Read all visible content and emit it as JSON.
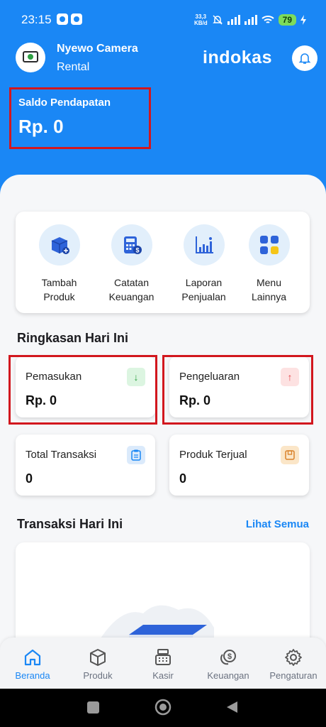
{
  "status_bar": {
    "time": "23:15",
    "net_speed_top": "33,3",
    "net_speed_bottom": "KB/d",
    "battery": "79"
  },
  "header": {
    "store_name": "Nyewo Camera",
    "store_subtitle": "Rental",
    "brand": "indokas"
  },
  "balance": {
    "label": "Saldo Pendapatan",
    "value": "Rp. 0"
  },
  "quick_menu": [
    {
      "line1": "Tambah",
      "line2": "Produk"
    },
    {
      "line1": "Catatan",
      "line2": "Keuangan"
    },
    {
      "line1": "Laporan",
      "line2": "Penjualan"
    },
    {
      "line1": "Menu",
      "line2": "Lainnya"
    }
  ],
  "summary": {
    "title": "Ringkasan Hari Ini",
    "income": {
      "label": "Pemasukan",
      "value": "Rp. 0",
      "icon": "arrow-down-icon"
    },
    "expense": {
      "label": "Pengeluaran",
      "value": "Rp. 0",
      "icon": "arrow-up-icon"
    },
    "total_tx": {
      "label": "Total Transaksi",
      "value": "0",
      "icon": "clipboard-icon"
    },
    "sold": {
      "label": "Produk Terjual",
      "value": "0",
      "icon": "box-icon"
    }
  },
  "transactions": {
    "title": "Transaksi Hari Ini",
    "see_all": "Lihat Semua"
  },
  "bottom_nav": [
    {
      "label": "Beranda",
      "icon": "home-icon"
    },
    {
      "label": "Produk",
      "icon": "cube-icon"
    },
    {
      "label": "Kasir",
      "icon": "cash-register-icon"
    },
    {
      "label": "Keuangan",
      "icon": "coins-icon"
    },
    {
      "label": "Pengaturan",
      "icon": "gear-icon"
    }
  ],
  "colors": {
    "primary": "#1a87f5",
    "highlight": "#d2171e",
    "income": "#2ea043",
    "expense": "#e5484d"
  }
}
